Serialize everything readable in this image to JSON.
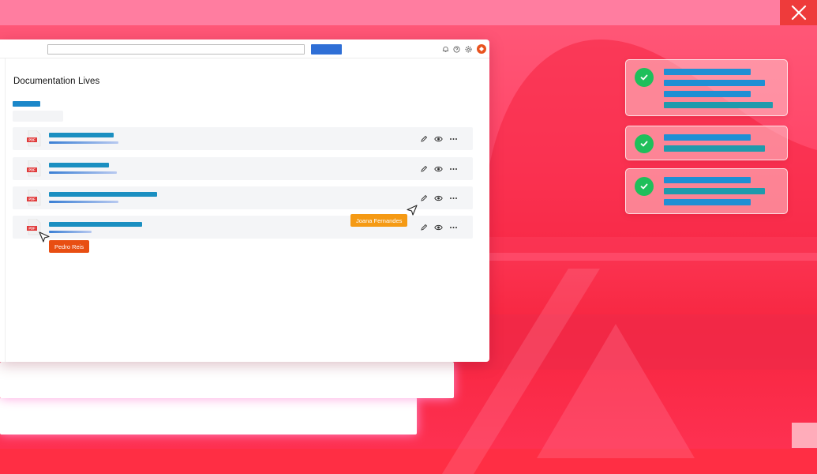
{
  "window": {
    "title": "Documentation Lives",
    "search": {
      "value": "",
      "placeholder": ""
    }
  },
  "toolbar_icons": [
    "bell-icon",
    "help-icon",
    "settings-icon",
    "user-avatar"
  ],
  "documents": [
    {
      "file_type": "PDF",
      "actions": [
        "edit-icon",
        "view-icon",
        "more-icon"
      ]
    },
    {
      "file_type": "PDF",
      "actions": [
        "edit-icon",
        "view-icon",
        "more-icon"
      ]
    },
    {
      "file_type": "PDF",
      "actions": [
        "edit-icon",
        "view-icon",
        "more-icon"
      ]
    },
    {
      "file_type": "PDF",
      "actions": [
        "edit-icon",
        "view-icon",
        "more-icon"
      ]
    }
  ],
  "collaborators": [
    {
      "name": "Joana Fernandes",
      "color": "#f59a14"
    },
    {
      "name": "Pedro Reis",
      "color": "#e84e12"
    }
  ],
  "notifications": [
    {
      "status": "check-icon",
      "lines": 4
    },
    {
      "status": "check-icon",
      "lines": 2
    },
    {
      "status": "check-icon",
      "lines": 3
    }
  ],
  "colors": {
    "background": "#ff3355",
    "accent_blue": "#2f6fd6",
    "teal_lines": "#1b8fc1",
    "success": "#1fbf5b",
    "close_button": "#ee3b3b"
  }
}
